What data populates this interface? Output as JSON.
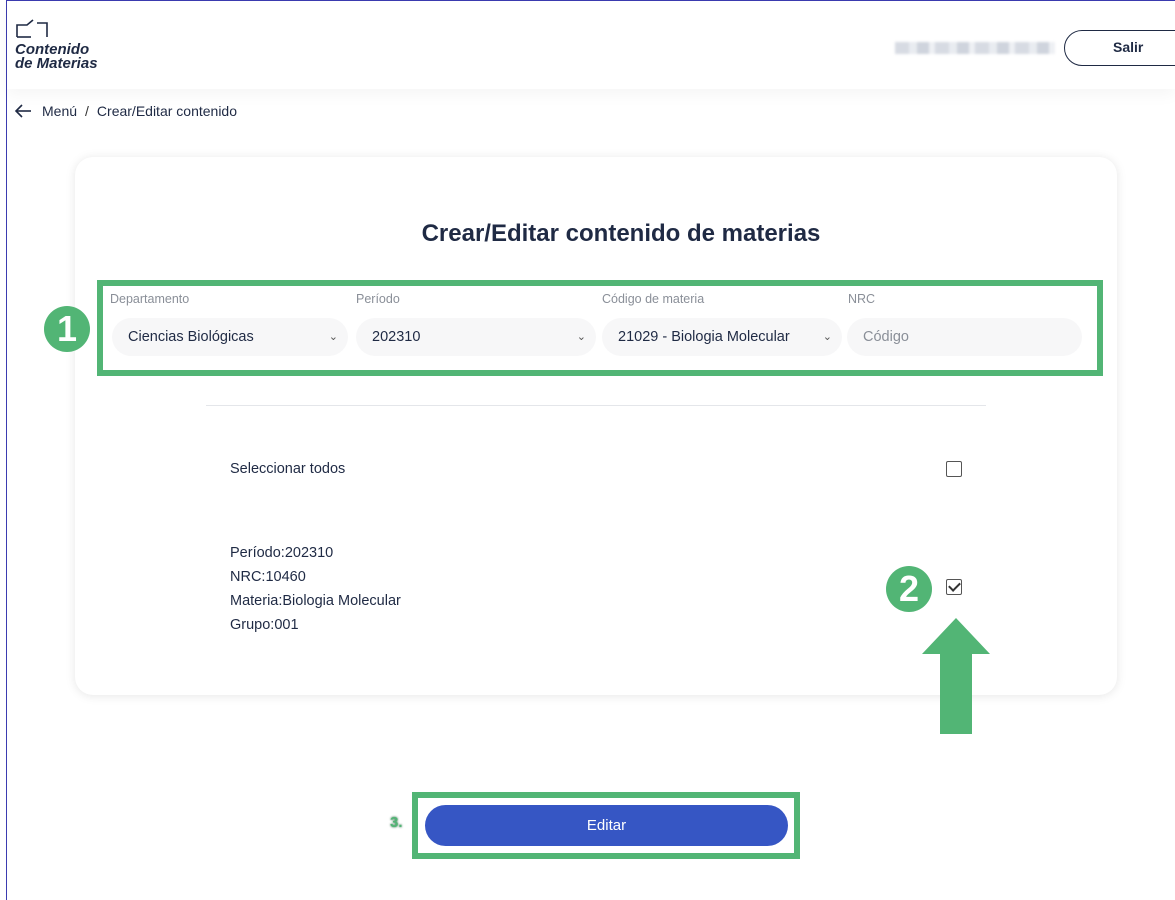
{
  "header": {
    "logo_line1": "Contenido",
    "logo_line2": "de Materias",
    "logout_label": "Salir"
  },
  "breadcrumb": {
    "menu": "Menú",
    "separator": "/",
    "current": "Crear/Editar contenido"
  },
  "page_title": "Crear/Editar contenido de materias",
  "filters": {
    "department": {
      "label": "Departamento",
      "value": "Ciencias Biológicas"
    },
    "period": {
      "label": "Período",
      "value": "202310"
    },
    "course_code": {
      "label": "Código de materia",
      "value": "21029 - Biologia Molecular"
    },
    "nrc": {
      "label": "NRC",
      "placeholder": "Código"
    }
  },
  "select_all": {
    "label": "Seleccionar todos",
    "checked": false
  },
  "course_item": {
    "period": "Período:202310",
    "nrc": "NRC:10460",
    "subject": "Materia:Biologia Molecular",
    "group": "Grupo:001",
    "checked": true
  },
  "submit_label": "Editar",
  "annotations": {
    "step1": "1",
    "step2": "2",
    "step3": "3.",
    "highlight_color": "#52b575"
  },
  "colors": {
    "primary_button": "#3656c4",
    "text_dark": "#1f2a44"
  }
}
